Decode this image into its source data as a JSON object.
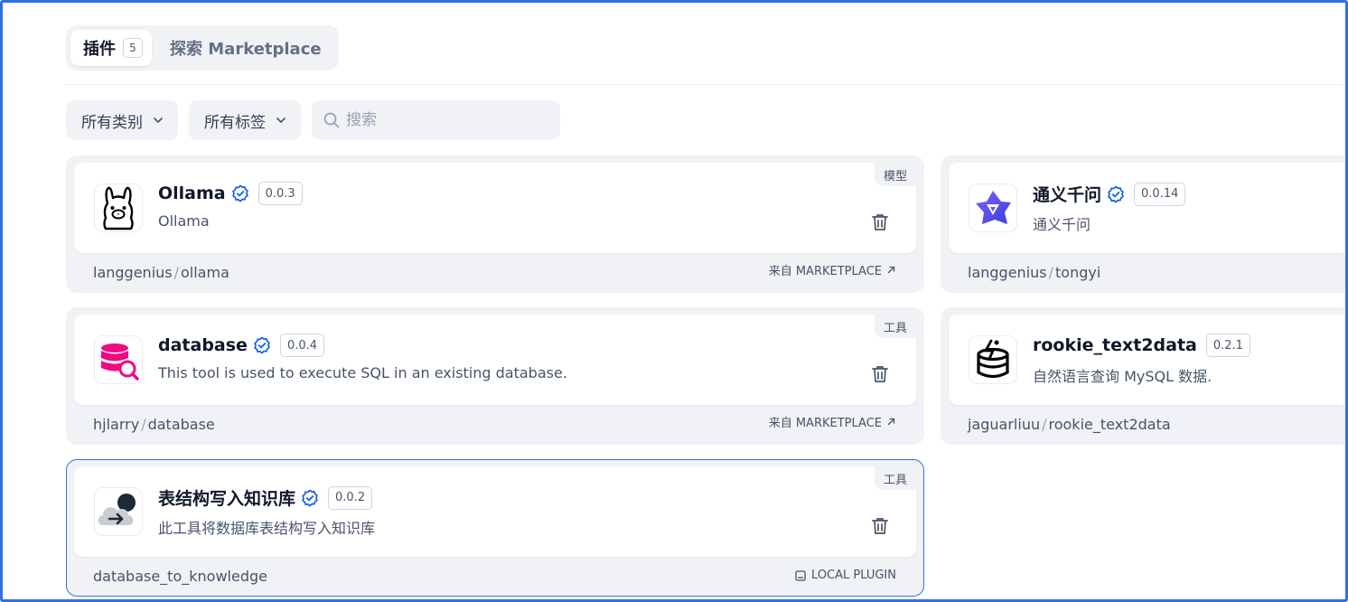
{
  "tabs": [
    {
      "label": "插件",
      "count": "5",
      "active": true
    },
    {
      "label": "探索 Marketplace",
      "active": false
    }
  ],
  "filters": {
    "category": "所有类别",
    "tags": "所有标签",
    "search_placeholder": "搜索"
  },
  "plugins": [
    {
      "name": "Ollama",
      "version": "0.0.3",
      "description": "Ollama",
      "category": "模型",
      "author": "langgenius",
      "slug": "ollama",
      "source": "来自 MARKETPLACE",
      "icon": "ollama-llama-icon",
      "verified": true
    },
    {
      "name": "通义千问",
      "version": "0.0.14",
      "description": "通义千问",
      "category": "",
      "author": "langgenius",
      "slug": "tongyi",
      "source": "",
      "icon": "tongyi-logo-icon",
      "verified": true
    },
    {
      "name": "database",
      "version": "0.0.4",
      "description": "This tool is used to execute SQL in an existing database.",
      "category": "工具",
      "author": "hjlarry",
      "slug": "database",
      "source": "来自 MARKETPLACE",
      "icon": "database-search-icon",
      "verified": true
    },
    {
      "name": "rookie_text2data",
      "version": "0.2.1",
      "description": "自然语言查询 MySQL 数据.",
      "category": "",
      "author": "jaguarliuu",
      "slug": "rookie_text2data",
      "source": "",
      "icon": "database-bolt-icon",
      "verified": false
    },
    {
      "name": "表结构写入知识库",
      "version": "0.0.2",
      "description": "此工具将数据库表结构写入知识库",
      "category": "工具",
      "author": "",
      "slug": "database_to_knowledge",
      "source": "LOCAL PLUGIN",
      "icon": "cloud-upload-icon",
      "verified": true,
      "selected": true
    }
  ],
  "colors": {
    "accent": "#2f6fe8",
    "verified": "#155eef",
    "database_pink": "#ee0a83"
  }
}
